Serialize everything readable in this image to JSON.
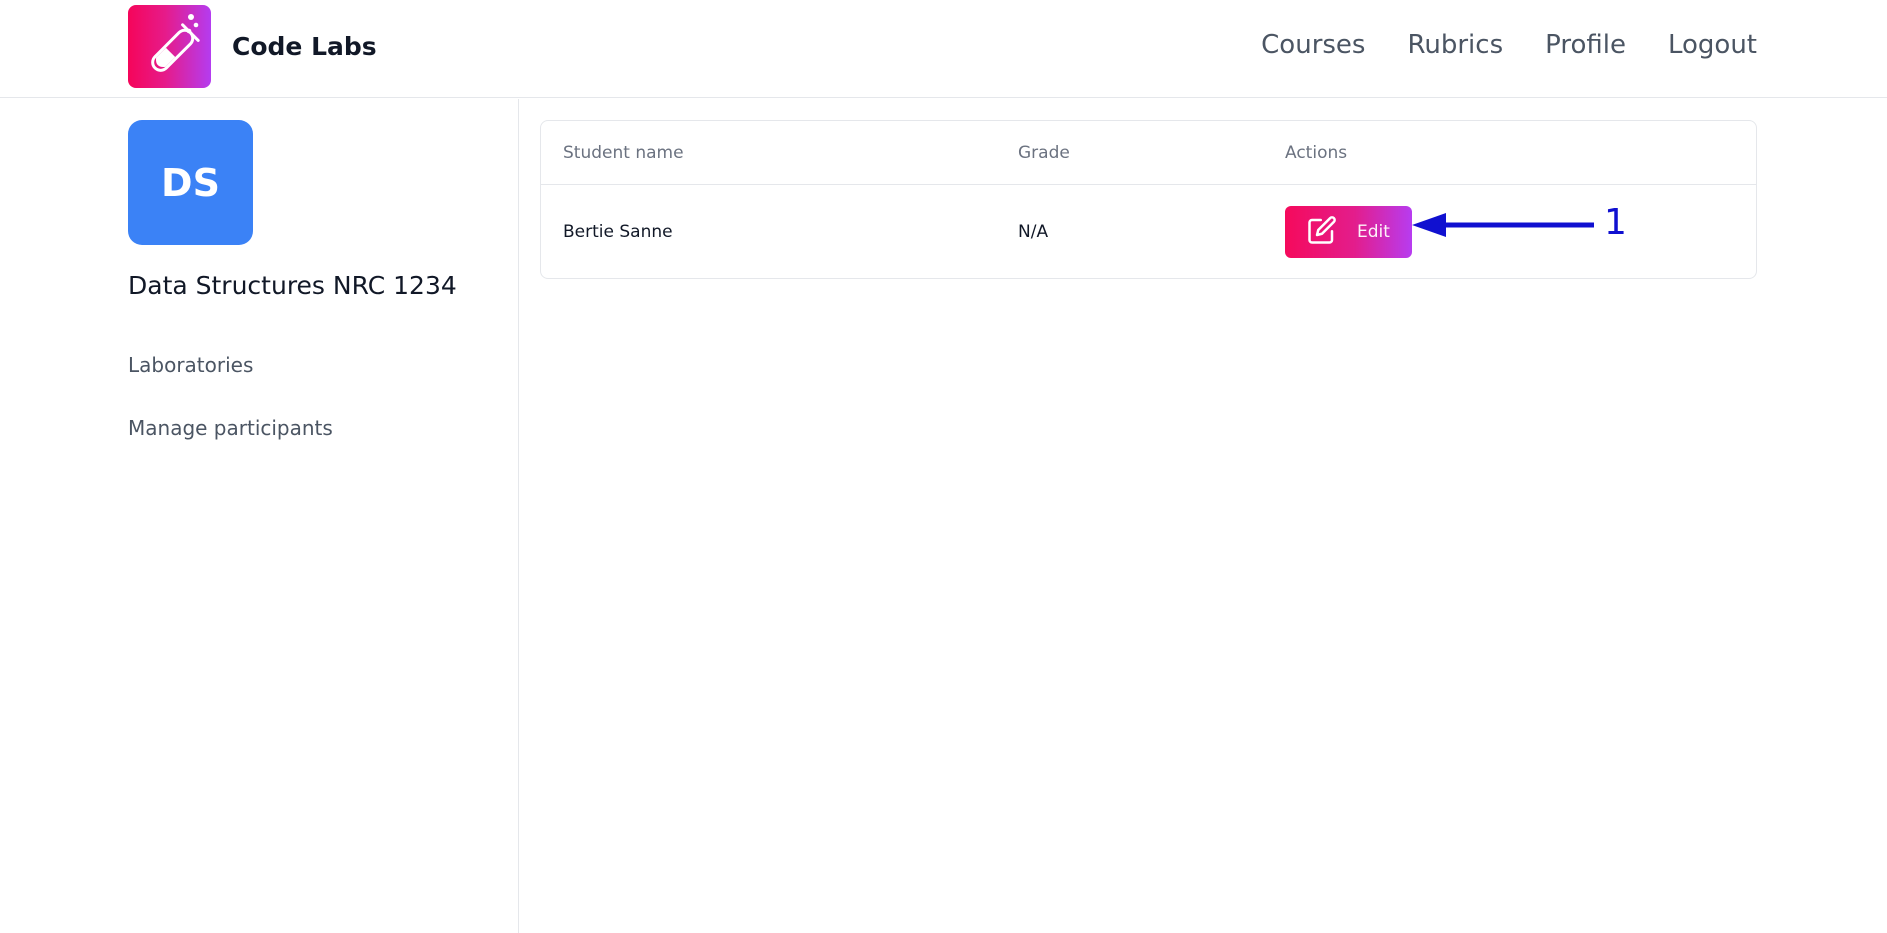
{
  "header": {
    "brand_name": "Code Labs",
    "nav": [
      "Courses",
      "Rubrics",
      "Profile",
      "Logout"
    ]
  },
  "sidebar": {
    "avatar_initials": "DS",
    "course_title": "Data Structures NRC 1234",
    "links": [
      "Laboratories",
      "Manage participants"
    ]
  },
  "table": {
    "columns": [
      "Student name",
      "Grade",
      "Actions"
    ],
    "rows": [
      {
        "student_name": "Bertie Sanne",
        "grade": "N/A",
        "action_label": "Edit"
      }
    ]
  },
  "annotation": {
    "label": "1",
    "color": "#1010d0"
  },
  "colors": {
    "brand_gradient_start": "#f5055a",
    "brand_gradient_end": "#b43cf0",
    "avatar_bg": "#3b82f6"
  },
  "icons": {
    "logo": "test-tube-icon",
    "edit": "edit-square-icon"
  }
}
